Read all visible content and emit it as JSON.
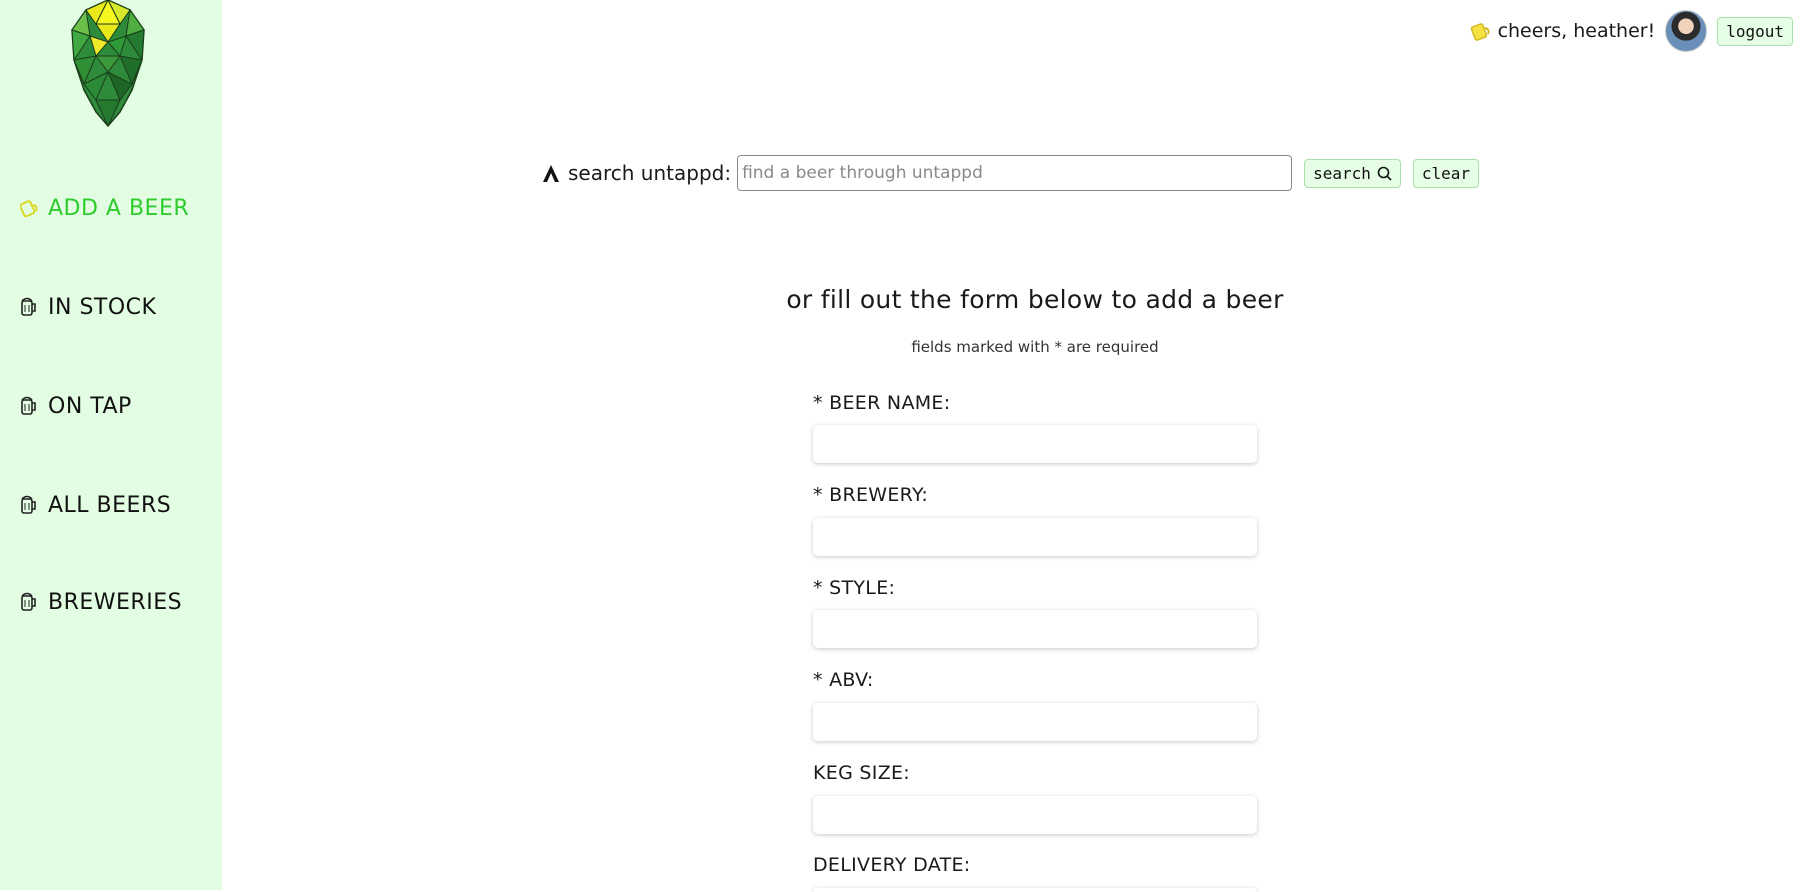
{
  "sidebar": {
    "items": [
      {
        "label": "ADD A BEER",
        "icon": "beer-mug-icon",
        "active": true
      },
      {
        "label": "IN STOCK",
        "icon": "beer-mug-icon"
      },
      {
        "label": "ON TAP",
        "icon": "beer-mug-icon"
      },
      {
        "label": "ALL BEERS",
        "icon": "beer-mug-icon"
      },
      {
        "label": "BREWERIES",
        "icon": "beer-mug-icon"
      }
    ]
  },
  "header": {
    "greeting": "cheers, heather!",
    "logout_label": "logout"
  },
  "search": {
    "label": "search untappd:",
    "placeholder": "find a beer through untappd",
    "search_label": "search",
    "clear_label": "clear"
  },
  "form": {
    "title": "or fill out the form below to add a beer",
    "subtitle": "fields marked with * are required",
    "fields": [
      {
        "label": "* BEER NAME:"
      },
      {
        "label": "* BREWERY:"
      },
      {
        "label": "* STYLE:"
      },
      {
        "label": "* ABV:"
      },
      {
        "label": "KEG SIZE:"
      },
      {
        "label": "DELIVERY DATE:"
      }
    ]
  },
  "colors": {
    "sidebar_bg": "#e2fde2",
    "active_nav": "#2ecc2e",
    "button_bg": "#e6fde6"
  }
}
